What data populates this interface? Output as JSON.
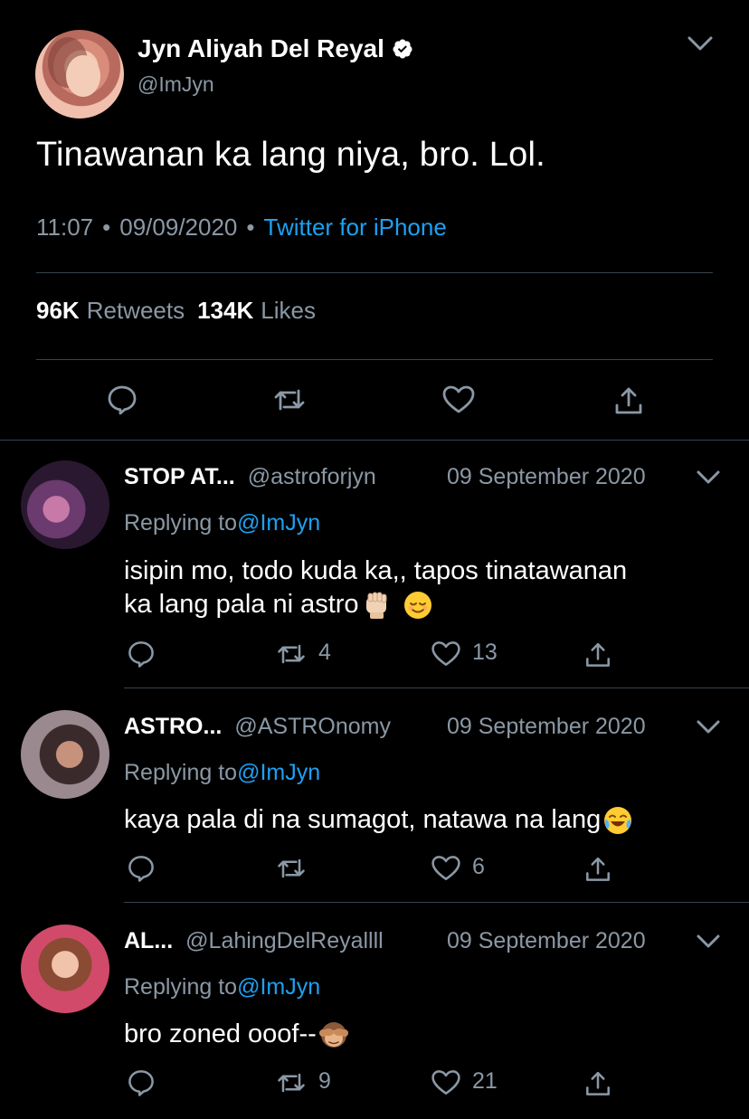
{
  "tweet": {
    "author_name": "Jyn Aliyah Del Reyal",
    "author_handle": "@ImJyn",
    "text": "Tinawanan ka lang niya, bro. Lol.",
    "time": "11:07",
    "separator": "•",
    "date": "09/09/2020",
    "source": "Twitter for iPhone",
    "retweets_count": "96K",
    "retweets_label": "Retweets",
    "likes_count": "134K",
    "likes_label": "Likes"
  },
  "replying_label": "Replying to",
  "replies": [
    {
      "name": "STOP AT...",
      "handle": "@astroforjyn",
      "date": "09 September 2020",
      "replying_to": "@ImJyn",
      "text_line1": "isipin mo, todo kuda ka,, tapos tinatawanan",
      "text_line2": "ka lang pala ni astro",
      "emojis": [
        "raised-fist",
        "relieved-face"
      ],
      "retweets": "4",
      "likes": "13"
    },
    {
      "name": "ASTRO...",
      "handle": "@ASTROnomy",
      "date": "09 September 2020",
      "replying_to": "@ImJyn",
      "text_line1": "kaya pala di na sumagot, natawa na lang",
      "emojis": [
        "face-with-tears-of-joy"
      ],
      "retweets": "",
      "likes": "6"
    },
    {
      "name": "AL...",
      "handle": "@LahingDelReyallll",
      "date": "09 September 2020",
      "replying_to": "@ImJyn",
      "text_line1": "bro zoned ooof--",
      "emojis": [
        "see-no-evil-monkey"
      ],
      "retweets": "9",
      "likes": "21"
    }
  ],
  "colors": {
    "background": "#000000",
    "primary_text": "#ffffff",
    "secondary_text": "#8b98a5",
    "accent": "#1da1f2",
    "divider": "#38444d"
  }
}
